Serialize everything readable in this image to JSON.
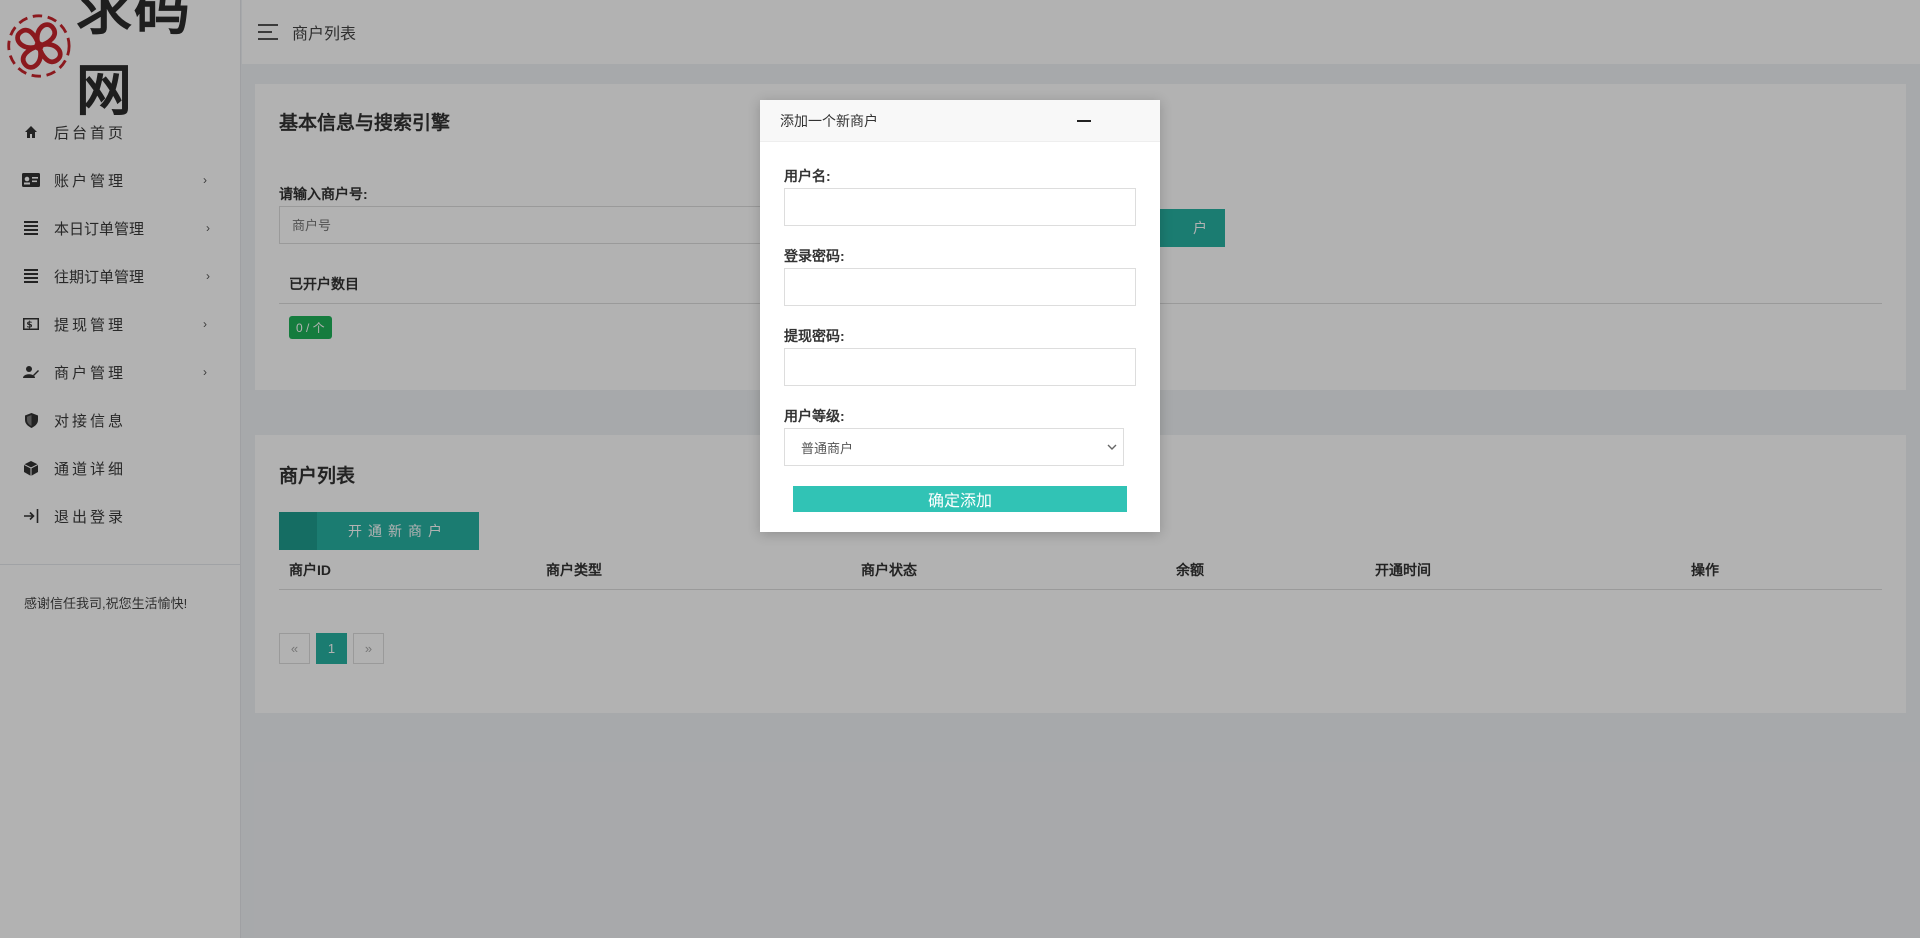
{
  "brand": {
    "name": "求码网"
  },
  "sidebar": {
    "items": [
      {
        "label": "后台首页",
        "icon": "home-icon",
        "has_arrow": false
      },
      {
        "label": "账户管理",
        "icon": "id-card-icon",
        "has_arrow": true
      },
      {
        "label": "本日订单管理",
        "icon": "list-icon",
        "has_arrow": true
      },
      {
        "label": "往期订单管理",
        "icon": "list-icon",
        "has_arrow": true
      },
      {
        "label": "提现管理",
        "icon": "money-icon",
        "has_arrow": true
      },
      {
        "label": "商户管理",
        "icon": "user-edit-icon",
        "has_arrow": true
      },
      {
        "label": "对接信息",
        "icon": "shield-icon",
        "has_arrow": false
      },
      {
        "label": "通道详细",
        "icon": "cube-icon",
        "has_arrow": false
      },
      {
        "label": "退出登录",
        "icon": "logout-icon",
        "has_arrow": false
      }
    ],
    "footer": "感谢信任我司,祝您生活愉快!"
  },
  "header": {
    "breadcrumb": "商户列表"
  },
  "search_card": {
    "title": "基本信息与搜索引擎",
    "field_label": "请输入商户号:",
    "placeholder": "商户号",
    "search_button": "户",
    "stats_header": "已开户数目",
    "count_badge": "0 / 个"
  },
  "list_card": {
    "title": "商户列表",
    "add_button": "开通新商户",
    "columns": [
      "商户ID",
      "商户类型",
      "商户状态",
      "余额",
      "开通时间",
      "操作"
    ],
    "pager": {
      "prev": "«",
      "current": "1",
      "next": "»"
    }
  },
  "modal": {
    "title": "添加一个新商户",
    "username_label": "用户名:",
    "login_password_label": "登录密码:",
    "withdraw_password_label": "提现密码:",
    "level_label": "用户等级:",
    "level_value": "普通商户",
    "submit": "确定添加"
  },
  "colors": {
    "accent": "#27b2a3",
    "badge": "#1fb25a",
    "logo_red": "#c8252c"
  }
}
